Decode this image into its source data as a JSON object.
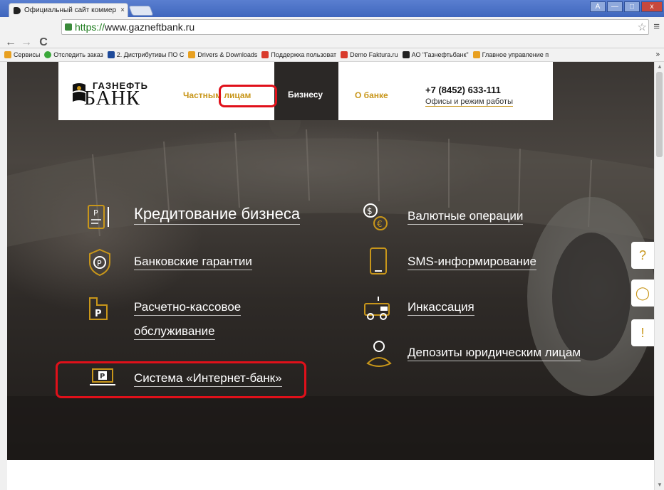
{
  "browser": {
    "tab_title": "Официальный сайт коммер",
    "tab_close": "×",
    "url_scheme": "https://",
    "url_rest": "www.gazneftbank.ru",
    "back": "←",
    "forward": "→",
    "reload": "C",
    "star": "☆",
    "menu": "≡",
    "window_buttons": [
      "A",
      "—",
      "□",
      "x"
    ]
  },
  "bookmarks": {
    "items": [
      {
        "label": "Сервисы",
        "color": "#e8a020"
      },
      {
        "label": "Отследить заказ",
        "color": "#3aa83a"
      },
      {
        "label": "2. Дистрибутивы ПО С",
        "color": "#1e4a9a"
      },
      {
        "label": "Drivers & Downloads",
        "color": "#e8a020"
      },
      {
        "label": "Поддержка пользоват",
        "color": "#d93a2b"
      },
      {
        "label": "Demo Faktura.ru",
        "color": "#d93a2b"
      },
      {
        "label": "АО \"Газнефтьбанк\"",
        "color": "#222222"
      },
      {
        "label": "Главное управление п",
        "color": "#e8a020"
      }
    ],
    "more": "»"
  },
  "site": {
    "logo_line1": "ГАЗНЕФТЬ",
    "logo_line2": "БАНК",
    "nav_private": "Частным лицам",
    "nav_business": "Бизнесу",
    "nav_about": "О банке",
    "phone": "+7 (8452) 633-111",
    "offices": "Офисы и режим работы"
  },
  "services": {
    "credit": "Кредитование бизнеса",
    "guarantees": "Банковские гарантии",
    "rko_line1": "Расчетно-кассовое",
    "rko_line2": "обслуживание",
    "internet_bank": "Система «Интернет-банк»",
    "currency": "Валютные операции",
    "sms": "SMS-информирование",
    "collection": "Инкассация",
    "deposits": "Депозиты юридическим лицам"
  },
  "side_buttons": {
    "question": "?",
    "chat": "◯",
    "alert": "!"
  },
  "colors": {
    "accent": "#c8961a",
    "highlight": "#e0101a",
    "business_bg": "#2b2826"
  }
}
